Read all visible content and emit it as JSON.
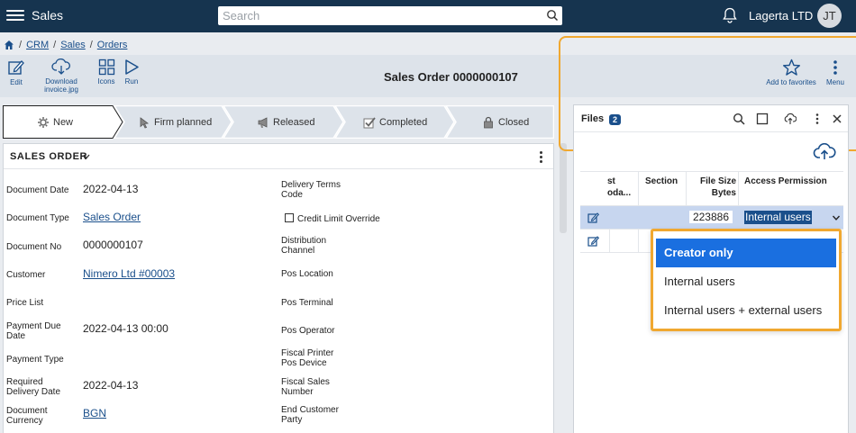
{
  "header": {
    "app_title": "Sales",
    "search_placeholder": "Search",
    "company": "Lagerta LTD",
    "avatar_initials": "JT"
  },
  "breadcrumb": [
    "CRM",
    "Sales",
    "Orders"
  ],
  "toolbar": {
    "edit": "Edit",
    "download_line1": "Download",
    "download_line2": "invoice.jpg",
    "icons": "Icons",
    "run": "Run",
    "favorites": "Add to favorites",
    "menu": "Menu",
    "title": "Sales Order 0000000107"
  },
  "stages": [
    {
      "label": "New",
      "icon": "gear-icon",
      "active": true
    },
    {
      "label": "Firm planned",
      "icon": "pointer-icon"
    },
    {
      "label": "Released",
      "icon": "megaphone-icon"
    },
    {
      "label": "Completed",
      "icon": "check-icon"
    },
    {
      "label": "Closed",
      "icon": "lock-icon"
    }
  ],
  "form": {
    "section_title": "SALES ORDER",
    "fields": {
      "document_date": {
        "label": "Document Date",
        "value": "2022-04-13"
      },
      "document_type": {
        "label": "Document Type",
        "value": "Sales Order"
      },
      "document_no": {
        "label": "Document No",
        "value": "0000000107"
      },
      "customer": {
        "label": "Customer",
        "value": "Nimero Ltd #00003"
      },
      "price_list": {
        "label": "Price List",
        "value": ""
      },
      "payment_due_date": {
        "label_line1": "Payment Due",
        "label_line2": "Date",
        "value": "2022-04-13 00:00"
      },
      "payment_type": {
        "label": "Payment Type",
        "value": ""
      },
      "required_delivery_date": {
        "label_line1": "Required",
        "label_line2": "Delivery Date",
        "value": "2022-04-13"
      },
      "document_currency": {
        "label_line1": "Document",
        "label_line2": "Currency",
        "value": "BGN"
      }
    },
    "right_fields": {
      "delivery_terms": {
        "line1": "Delivery Terms",
        "line2": "Code"
      },
      "credit_limit_override": "Credit Limit Override",
      "distribution_channel": {
        "line1": "Distribution",
        "line2": "Channel"
      },
      "pos_location": "Pos Location",
      "pos_terminal": "Pos Terminal",
      "pos_operator": "Pos Operator",
      "fiscal_printer": {
        "line1": "Fiscal Printer",
        "line2": "Pos Device"
      },
      "fiscal_sales": {
        "line1": "Fiscal Sales",
        "line2": "Number"
      },
      "end_customer": {
        "line1": "End Customer",
        "line2": "Party"
      }
    }
  },
  "files": {
    "title": "Files",
    "count": "2",
    "columns": {
      "first_line1": "st",
      "first_line2": "oda...",
      "section": "Section",
      "file_size_line1": "File Size",
      "file_size_line2": "Bytes",
      "access": "Access Permission"
    },
    "rows": [
      {
        "file_size": "223886",
        "access": "Internal users"
      },
      {
        "file_size": "",
        "access": ""
      }
    ]
  },
  "dropdown": {
    "options": [
      "Creator only",
      "Internal users",
      "Internal users + external users"
    ],
    "highlighted": "Creator only"
  },
  "colors": {
    "topbar": "#16344f",
    "link": "#1a4f8b",
    "highlight": "#f0a830",
    "option_active": "#1a6fe0"
  }
}
